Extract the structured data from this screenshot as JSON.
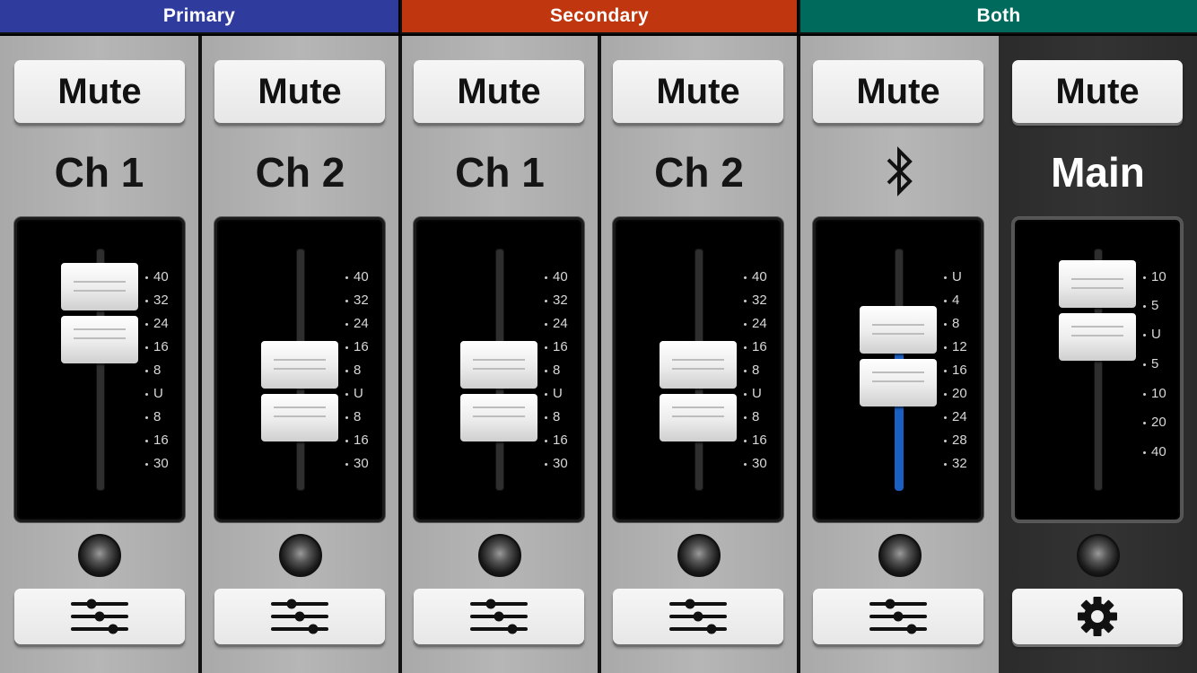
{
  "groups": [
    {
      "label": "Primary",
      "color": "#2f3c9e"
    },
    {
      "label": "Secondary",
      "color": "#c0360e"
    },
    {
      "label": "Both",
      "color": "#006b5c"
    }
  ],
  "channels": [
    {
      "mute_label": "Mute",
      "name": "Ch 1",
      "scale": [
        "40",
        "32",
        "24",
        "16",
        "8",
        "U",
        "8",
        "16",
        "30"
      ],
      "settings_icon": "sliders-icon"
    },
    {
      "mute_label": "Mute",
      "name": "Ch 2",
      "scale": [
        "40",
        "32",
        "24",
        "16",
        "8",
        "U",
        "8",
        "16",
        "30"
      ],
      "settings_icon": "sliders-icon"
    },
    {
      "mute_label": "Mute",
      "name": "Ch 1",
      "scale": [
        "40",
        "32",
        "24",
        "16",
        "8",
        "U",
        "8",
        "16",
        "30"
      ],
      "settings_icon": "sliders-icon"
    },
    {
      "mute_label": "Mute",
      "name": "Ch 2",
      "scale": [
        "40",
        "32",
        "24",
        "16",
        "8",
        "U",
        "8",
        "16",
        "30"
      ],
      "settings_icon": "sliders-icon"
    },
    {
      "mute_label": "Mute",
      "name_icon": "bluetooth-icon",
      "scale": [
        "U",
        "4",
        "8",
        "12",
        "16",
        "20",
        "24",
        "28",
        "32"
      ],
      "settings_icon": "sliders-icon",
      "level_color": "#1a5fc2"
    },
    {
      "mute_label": "Mute",
      "name": "Main",
      "scale": [
        "10",
        "5",
        "U",
        "5",
        "10",
        "20",
        "40"
      ],
      "settings_icon": "gear-icon"
    }
  ]
}
